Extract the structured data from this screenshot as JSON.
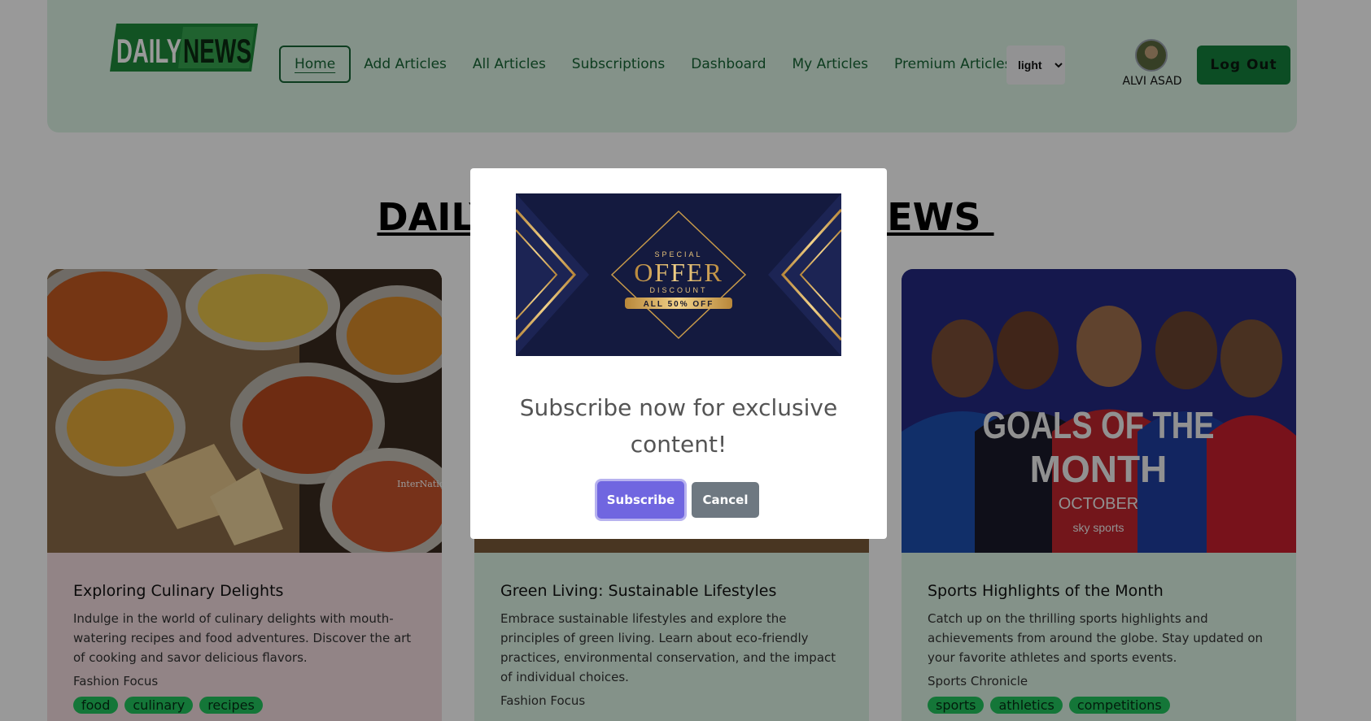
{
  "brand": {
    "logo_word_1": "DAILY",
    "logo_word_2": "NEWS"
  },
  "nav": {
    "links": [
      "Home",
      "Add Articles",
      "All Articles",
      "Subscriptions",
      "Dashboard",
      "My Articles",
      "Premium Articles"
    ],
    "active_index": 0,
    "theme_select": {
      "value": "light",
      "options": [
        "light"
      ]
    }
  },
  "user": {
    "name": "ALVI ASAD"
  },
  "logout_label": "Log Out",
  "page_title": "DAILY NEWS",
  "page_title_visible": "DAILY                              EWS ",
  "cards": [
    {
      "title": "Exploring Culinary Delights",
      "description": "Indulge in the world of culinary delights with mouth-watering recipes and food adventures. Discover the art of cooking and savor delicious flavors.",
      "source": "Fashion Focus",
      "tags": [
        "food",
        "culinary",
        "recipes"
      ],
      "background": "#f3dcdf"
    },
    {
      "title": "Green Living: Sustainable Lifestyles",
      "description": "Embrace sustainable lifestyles and explore the principles of green living. Learn about eco-friendly practices, environmental conservation, and the impact of individual choices.",
      "source": "Fashion Focus",
      "tags": [],
      "background": "#dcf3e4"
    },
    {
      "title": "Sports Highlights of the Month",
      "description": "Catch up on the thrilling sports highlights and achievements from around the globe. Stay updated on your favorite athletes and sports events.",
      "source": "Sports Chronicle",
      "tags": [
        "sports",
        "athletics",
        "competitions"
      ],
      "background": "#dcf3e4"
    }
  ],
  "card_images": {
    "sports_text_line_1": "GOALS OF THE",
    "sports_text_line_2": "MONTH",
    "sports_text_line_3": "OCTOBER",
    "sports_brand": "sky sports",
    "food_watermark": "InterNations"
  },
  "modal": {
    "banner": {
      "top_text": "SPECIAL",
      "main_text": "OFFER",
      "sub_text": "DISCOUNT",
      "ribbon_text": "ALL 50% OFF"
    },
    "message": "Subscribe now for exclusive content!",
    "subscribe_label": "Subscribe",
    "cancel_label": "Cancel"
  },
  "colors": {
    "brand_green": "#15803d",
    "nav_bg": "#dcf3e4",
    "subscribe_purple": "#7066e0",
    "cancel_gray": "#6e7881"
  }
}
